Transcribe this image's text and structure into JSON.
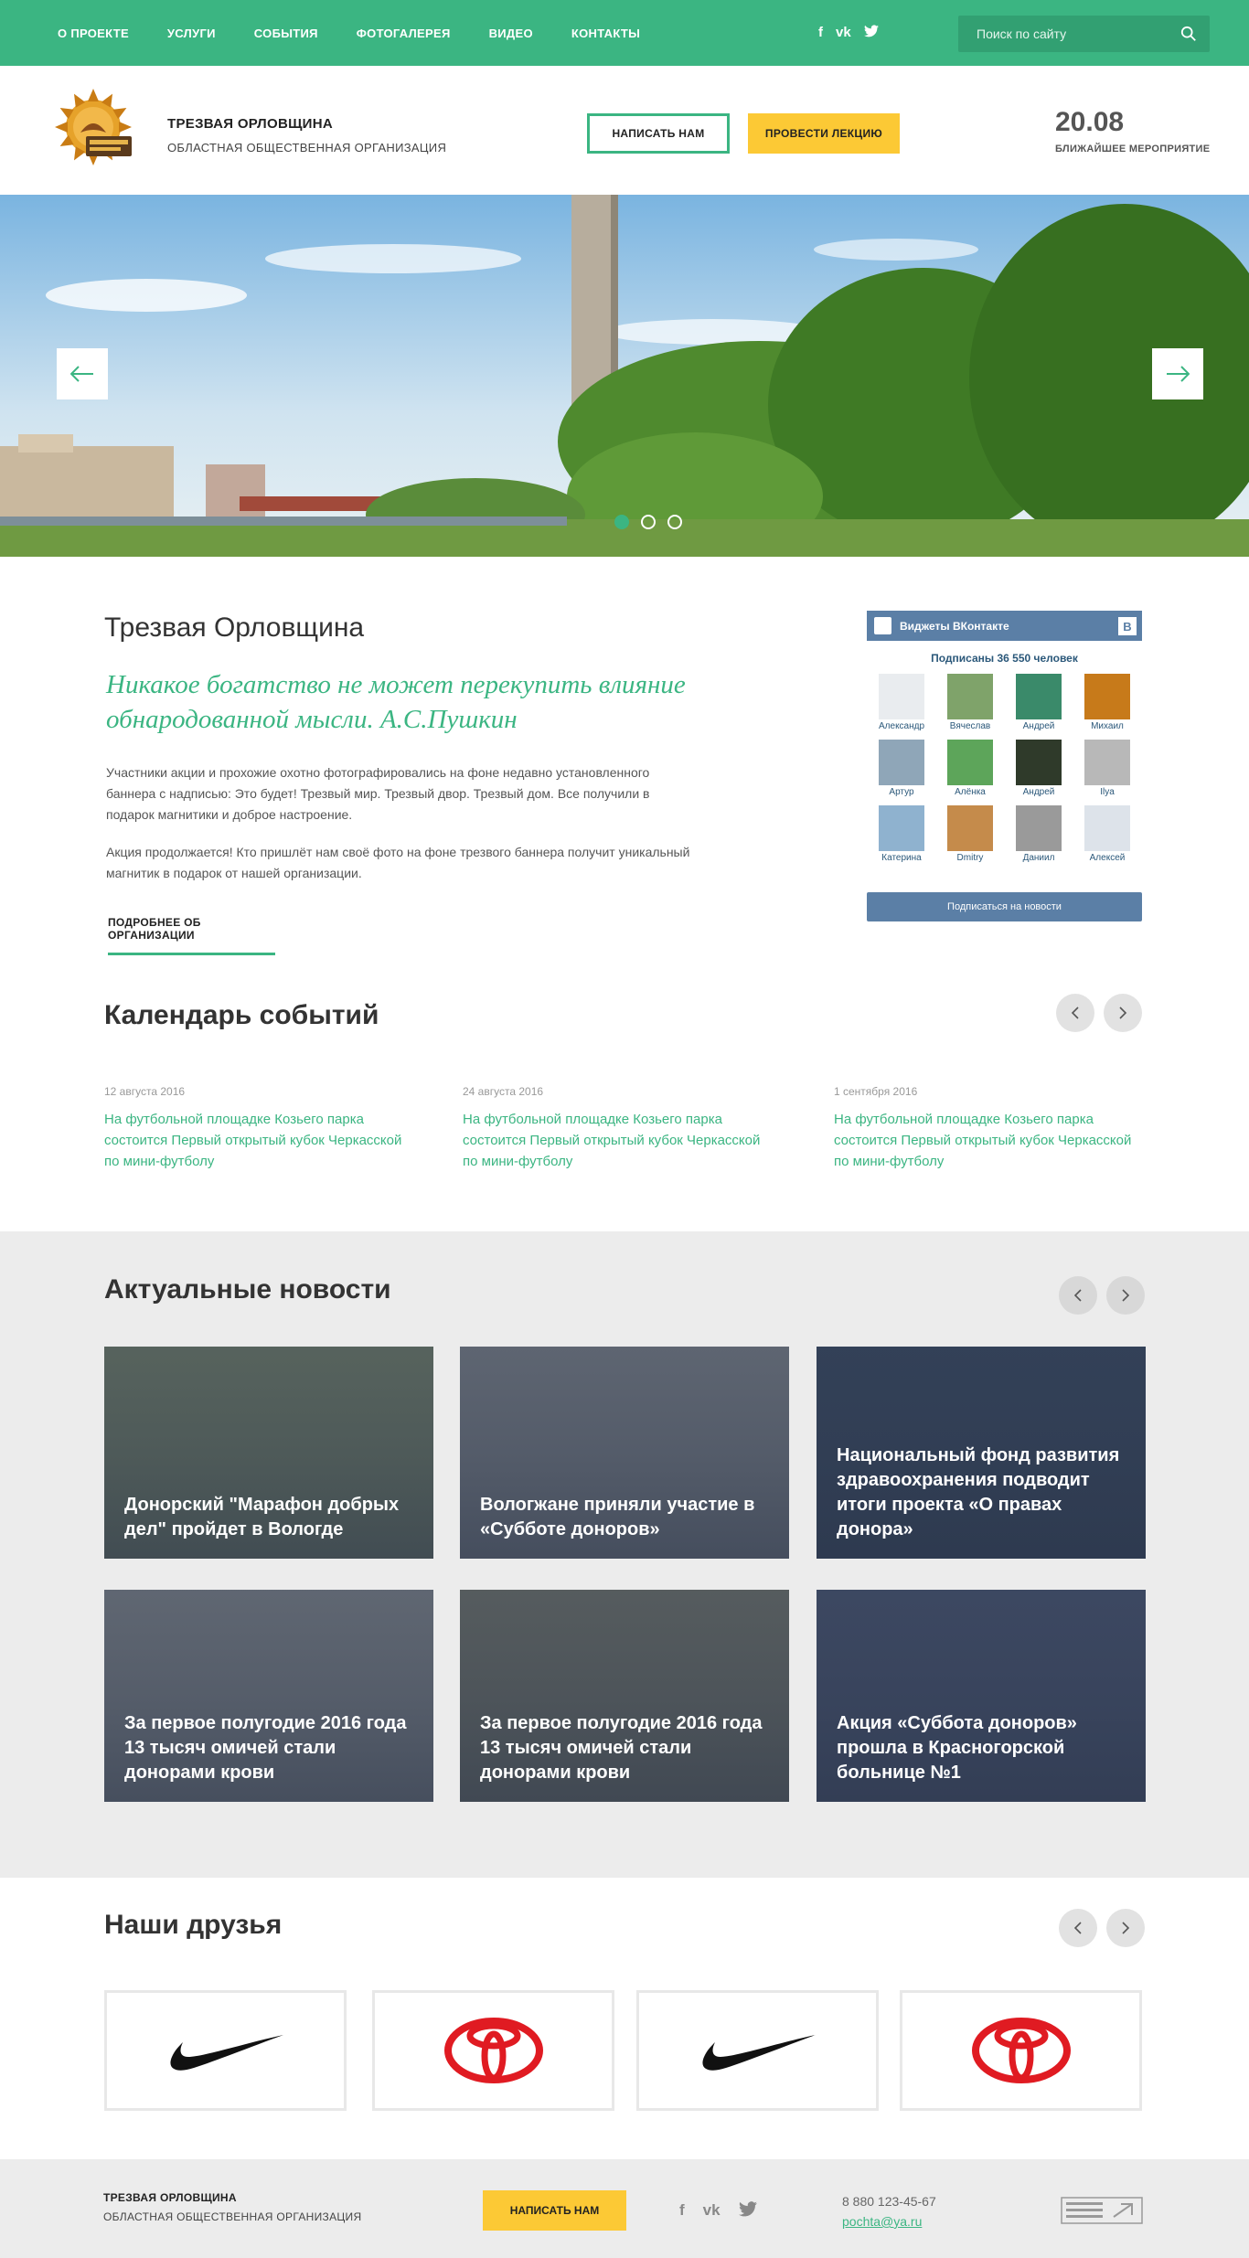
{
  "theme": {
    "accent": "#3bb582",
    "yellow": "#fcc935",
    "vk_blue": "#5b7fa6",
    "news_bg": "#ececec"
  },
  "topnav": {
    "items": [
      "О ПРОЕКТЕ",
      "УСЛУГИ",
      "СОБЫТИЯ",
      "ФОТОГАЛЕРЕЯ",
      "ВИДЕО",
      "КОНТАКТЫ"
    ],
    "social": [
      "facebook-icon",
      "vk-icon",
      "twitter-icon"
    ],
    "search_placeholder": "Поиск по сайту"
  },
  "header": {
    "org_title": "ТРЕЗВАЯ ОРЛОВЩИНА",
    "org_subtitle": "ОБЛАСТНАЯ ОБЩЕСТВЕННАЯ ОРГАНИЗАЦИЯ",
    "btn_write": "НАПИСАТЬ НАМ",
    "btn_lecture": "ПРОВЕСТИ ЛЕКЦИЮ",
    "event_date": "20.08",
    "event_label": "БЛИЖАЙШЕЕ МЕРОПРИЯТИЕ"
  },
  "slider": {
    "slides": 3,
    "active": 1
  },
  "about": {
    "title": "Трезвая Орловщина",
    "quote": "Никакое богатство не может перекупить влияние обнародованной мысли. А.С.Пушкин",
    "para1": "Участники акции и прохожие охотно фотографировались на фоне недавно установленного баннера с надписью: Это будет! Трезвый мир. Трезвый двор. Трезвый дом. Все получили в подарок магнитики и доброе настроение.",
    "para2": "Акция продолжается! Кто пришлёт нам своё фото на фоне трезвого баннера получит уникальный магнитик в подарок от нашей организации.",
    "more": "ПОДРОБНЕЕ ОБ ОРГАНИЗАЦИИ"
  },
  "vk": {
    "title": "Виджеты ВКонтакте",
    "badge": "B",
    "subscribers": "Подписаны 36 550 человек",
    "users": [
      {
        "name": "Александр",
        "color": "#e9ecef"
      },
      {
        "name": "Вячеслав",
        "color": "#7fa36a"
      },
      {
        "name": "Андрей",
        "color": "#3a8a6a"
      },
      {
        "name": "Михаил",
        "color": "#c77a1a"
      },
      {
        "name": "Артур",
        "color": "#8fa6b8"
      },
      {
        "name": "Алёнка",
        "color": "#5da55a"
      },
      {
        "name": "Андрей",
        "color": "#2f3a2a"
      },
      {
        "name": "Ilya",
        "color": "#b8b8b8"
      },
      {
        "name": "Катерина",
        "color": "#8fb2cf"
      },
      {
        "name": "Dmitry",
        "color": "#c58b4b"
      },
      {
        "name": "Даниил",
        "color": "#9a9a9a"
      },
      {
        "name": "Алексей",
        "color": "#dde3ea"
      }
    ],
    "subscribe": "Подписаться на новости"
  },
  "calendar": {
    "title": "Календарь событий",
    "events": [
      {
        "date": "12 августа 2016",
        "text": "На футбольной площадке Козьего парка состоится Первый открытый кубок Черкасской по мини-футболу"
      },
      {
        "date": "24 августа 2016",
        "text": "На футбольной площадке Козьего парка состоится Первый открытый кубок Черкасской по мини-футболу"
      },
      {
        "date": "1 сентября 2016",
        "text": "На футбольной площадке Козьего парка состоится Первый открытый кубок Черкасской по мини-футболу"
      }
    ]
  },
  "news": {
    "title": "Актуальные новости",
    "items": [
      {
        "text": "Донорский \"Марафон добрых дел\" пройдет в Вологде",
        "tone": "#7d8b70"
      },
      {
        "text": "Вологжане приняли участие в «Субботе доноров»",
        "tone": "#8a8f95"
      },
      {
        "text": "Национальный фонд развития здравоохранения подводит итоги проекта «О правах донора»",
        "tone": "#3c4d66"
      },
      {
        "text": "За первое полугодие 2016 года 13 тысяч омичей стали донорами крови",
        "tone": "#8d9296"
      },
      {
        "text": "За первое полугодие 2016 года 13 тысяч омичей стали донорами крови",
        "tone": "#7b7e72"
      },
      {
        "text": "Акция «Суббота доноров» прошла в Красногорской больнице №1",
        "tone": "#4d5a78"
      }
    ]
  },
  "friends": {
    "title": "Наши друзья",
    "logos": [
      "nike-logo",
      "toyota-logo",
      "nike-logo",
      "toyota-logo"
    ]
  },
  "footer": {
    "org_title": "ТРЕЗВАЯ ОРЛОВЩИНА",
    "org_subtitle": "ОБЛАСТНАЯ ОБЩЕСТВЕННАЯ ОРГАНИЗАЦИЯ",
    "btn_write": "НАПИСАТЬ НАМ",
    "phone": "8 880 123-45-67",
    "email": "pochta@ya.ru"
  }
}
